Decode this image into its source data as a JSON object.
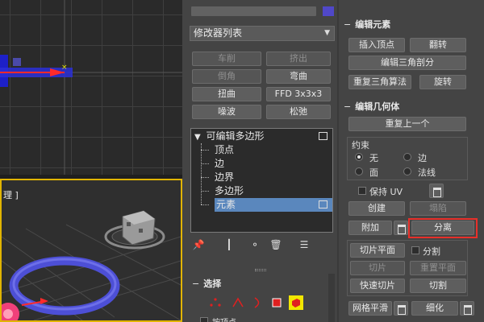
{
  "viewports": {
    "perspective_label": "理 ]"
  },
  "modifier_list": {
    "label": "修改器列表"
  },
  "modifier_buttons": [
    {
      "label": "车削",
      "enabled": false
    },
    {
      "label": "挤出",
      "enabled": false
    },
    {
      "label": "倒角",
      "enabled": false
    },
    {
      "label": "弯曲",
      "enabled": true
    },
    {
      "label": "扭曲",
      "enabled": true
    },
    {
      "label": "FFD 3x3x3",
      "enabled": true
    },
    {
      "label": "噪波",
      "enabled": true
    },
    {
      "label": "松弛",
      "enabled": true
    }
  ],
  "stack": {
    "root": "可编辑多边形",
    "items": [
      "顶点",
      "边",
      "边界",
      "多边形",
      "元素"
    ],
    "selected": "元素"
  },
  "selection_rollout": {
    "title": "选择",
    "partial_label": "按顶点"
  },
  "edit_elements": {
    "title": "编辑元素",
    "insert_vertex": "插入顶点",
    "flip": "翻转",
    "edit_triangulation": "编辑三角剖分",
    "retriangulate": "重复三角算法",
    "turn": "旋转"
  },
  "edit_geometry": {
    "title": "编辑几何体",
    "repeat_last": "重复上一个",
    "constraints_label": "约束",
    "constraint_none": "无",
    "constraint_edge": "边",
    "constraint_face": "面",
    "constraint_normal": "法线",
    "preserve_uv": "保持 UV",
    "create": "创建",
    "collapse": "塌陷",
    "attach": "附加",
    "detach": "分离",
    "slice_plane": "切片平面",
    "split": "分割",
    "slice": "切片",
    "reset_plane": "重置平面",
    "quickslice": "快速切片",
    "cut": "切割",
    "meshsmooth": "网格平滑",
    "tessellate": "细化"
  },
  "colors": {
    "accent_selected": "#5a87bd",
    "active_viewport_border": "#e1b400",
    "highlight_box": "#e8302a",
    "object_color": "#5048c8"
  }
}
